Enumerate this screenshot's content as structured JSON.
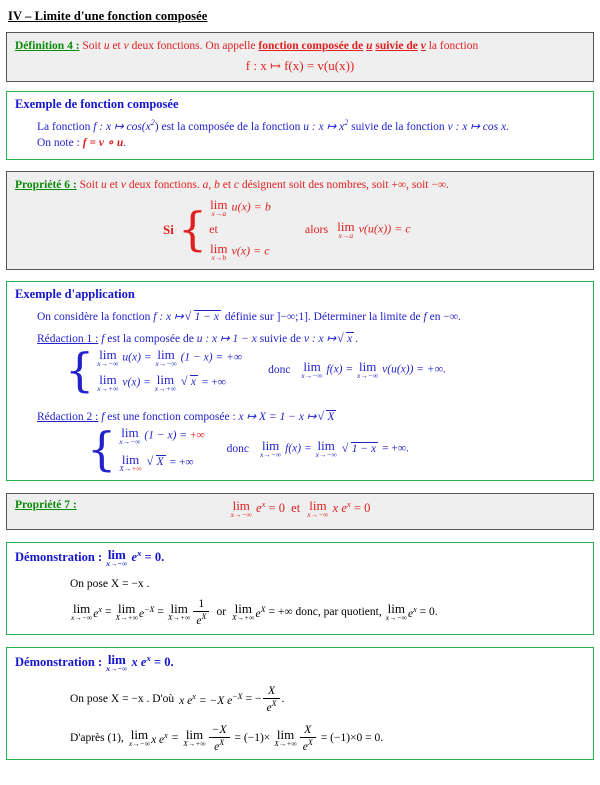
{
  "document": {
    "section_heading": "IV – Limite d'une fonction composée",
    "colors": {
      "green_label": "#0a8a0a",
      "green_border": "#22b14c",
      "blue_label": "#1515cf",
      "red_text": "#e02020",
      "blue_text": "#2222cc",
      "gray_box_bg": "#efefef",
      "gray_box_border": "#555555"
    }
  },
  "definition4": {
    "label": "Définition 4 :",
    "lead": "Soit",
    "u": "u",
    "and": "et",
    "v": "v",
    "rest": "deux fonctions. On appelle",
    "emphasis_1": "fonction composée de",
    "emphasis_u": "u",
    "emphasis_2": "suivie de",
    "emphasis_v": "v",
    "tail": "la fonction",
    "formula": "f : x ↦ f(x) = v(u(x))"
  },
  "example_composition": {
    "title": "Exemple de fonction composée",
    "line1_a": "La fonction",
    "line1_f": "f : x ↦ cos(x",
    "line1_exp": "2",
    "line1_b": ") est la composée de la fonction",
    "line1_u": "u : x ↦ x",
    "line1_uexp": "2",
    "line1_c": "suivie de la fonction",
    "line1_v": "v : x ↦ cos x",
    "line1_end": ".",
    "line2_a": "On note :",
    "line2_formula": "f = v ∘ u",
    "line2_end": "."
  },
  "property6": {
    "label": "Propriété 6 :",
    "lead": "Soit",
    "u": "u",
    "and": "et",
    "v": "v",
    "rest": "deux fonctions.",
    "abc": "a, b",
    "et_c": "et",
    "c": "c",
    "tail": "désignent soit des nombres, soit",
    "plus_inf": "+∞",
    "comma_soit": ", soit",
    "minus_inf": "−∞",
    "period": ".",
    "si": "Si",
    "alors": "alors",
    "row1_lim": "lim",
    "row1_under": "x→a",
    "row1_expr": "u(x) = b",
    "row2": "et",
    "row3_lim": "lim",
    "row3_under": "x→b",
    "row3_expr": "v(x) = c",
    "concl_lim": "lim",
    "concl_under": "x→a",
    "concl_expr": "v(u(x)) = c"
  },
  "example_application": {
    "title": "Exemple d'application",
    "intro_a": "On considère la fonction",
    "intro_f": "f : x ↦",
    "intro_sqrt": "1 − x",
    "intro_b": "définie sur",
    "intro_interval": "]−∞;1]",
    "intro_c": ". Déterminer la limite de",
    "intro_fl": "f",
    "intro_d": "en",
    "intro_minf": "−∞",
    "intro_end": ".",
    "redaction1": {
      "label": "Rédaction 1 :",
      "text_a": "f",
      "text_b": "est la composée de",
      "text_u": "u : x ↦ 1 − x",
      "text_c": "suivie de",
      "text_v": "v : x ↦",
      "text_vsqrt": "x",
      "text_end": ".",
      "r1_lim1": "lim",
      "r1_lim1_u": "x→−∞",
      "r1_expr1": "u(x) =",
      "r1_lim2": "lim",
      "r1_lim2_u": "x→−∞",
      "r1_expr2": "(1 − x) = +∞",
      "r2_lim1": "lim",
      "r2_lim1_u": "x→+∞",
      "r2_expr1": "v(x) =",
      "r2_lim2": "lim",
      "r2_lim2_u": "x→+∞",
      "r2_sqrt": "x",
      "r2_expr2": "= +∞",
      "donc": "donc",
      "concl_lim1": "lim",
      "concl_lim1_u": "x→−∞",
      "concl_f": "f(x) =",
      "concl_lim2": "lim",
      "concl_lim2_u": "x→−∞",
      "concl_expr": "v(u(x)) = +∞",
      "concl_end": "."
    },
    "redaction2": {
      "label": "Rédaction 2 :",
      "text_a": "f",
      "text_b": "est une fonction composée :",
      "text_map": "x ↦ X = 1 − x ↦",
      "text_sqrt": "X",
      "r1_lim": "lim",
      "r1_lim_u": "x→−∞",
      "r1_expr": "(1 − x) =",
      "r1_result": "+∞",
      "r2_lim": "lim",
      "r2_lim_u_a": "X→",
      "r2_lim_u_b": "+∞",
      "r2_sqrt": "X",
      "r2_expr": "= +∞",
      "donc": "donc",
      "concl_lim1": "lim",
      "concl_lim1_u": "x→−∞",
      "concl_f": "f(x) =",
      "concl_lim2": "lim",
      "concl_lim2_u": "x→−∞",
      "concl_sqrt": "1 − x",
      "concl_expr": "= +∞",
      "concl_end": "."
    }
  },
  "property7": {
    "label": "Propriété 7 :",
    "lim1": "lim",
    "lim1_under": "x→−∞",
    "expr1_e": "e",
    "expr1_sup": "x",
    "expr1_eq": "= 0",
    "et": "et",
    "lim2": "lim",
    "lim2_under": "x→−∞",
    "expr2_x": "x e",
    "expr2_sup": "x",
    "expr2_eq": "= 0"
  },
  "demonstration1": {
    "label": "Démonstration :",
    "title_lim": "lim",
    "title_under": "x→−∞",
    "title_e": "e",
    "title_sup": "x",
    "title_eq": "= 0.",
    "line1": "On pose X = −x .",
    "l_a_lim": "lim",
    "l_a_u": "x→−∞",
    "l_a_e": "e",
    "l_a_sup": "x",
    "eq1": "=",
    "l_b_lim": "lim",
    "l_b_u": "X→+∞",
    "l_b_e": "e",
    "l_b_sup": "−X",
    "eq2": "=",
    "l_c_lim": "lim",
    "l_c_u": "X→+∞",
    "frac_num": "1",
    "frac_den_e": "e",
    "frac_den_sup": "X",
    "or": "or",
    "l_d_lim": "lim",
    "l_d_u": "X→+∞",
    "l_d_e": "e",
    "l_d_sup": "X",
    "l_d_eq": "= +∞ donc, par quotient,",
    "l_e_lim": "lim",
    "l_e_u": "x→−∞",
    "l_e_e": "e",
    "l_e_sup": "x",
    "l_e_eq": "= 0."
  },
  "demonstration2": {
    "label": "Démonstration :",
    "title_lim": "lim",
    "title_under": "x→−∞",
    "title_x": "x e",
    "title_sup": "x",
    "title_eq": "= 0.",
    "line1_a": "On pose X = −x . D'où",
    "line1_xe": "x e",
    "line1_sup": "x",
    "line1_mid": "= −X e",
    "line1_sup2": "−X",
    "line1_eq": "= −",
    "line1_frac_num": "X",
    "line1_frac_den_e": "e",
    "line1_frac_den_sup": "X",
    "line1_end": ".",
    "line2_a": "D'après (1),",
    "line2_lim1": "lim",
    "line2_lim1_u": "x→−∞",
    "line2_xe": "x e",
    "line2_sup": "x",
    "line2_eq1": "=",
    "line2_lim2": "lim",
    "line2_lim2_u": "X→+∞",
    "line2_f1_num": "−X",
    "line2_f1_den_e": "e",
    "line2_f1_den_sup": "X",
    "line2_eq2": "= (−1)×",
    "line2_lim3": "lim",
    "line2_lim3_u": "X→+∞",
    "line2_f2_num": "X",
    "line2_f2_den_e": "e",
    "line2_f2_den_sup": "X",
    "line2_eq3": "= (−1)×0 = 0",
    "line2_end": "."
  }
}
